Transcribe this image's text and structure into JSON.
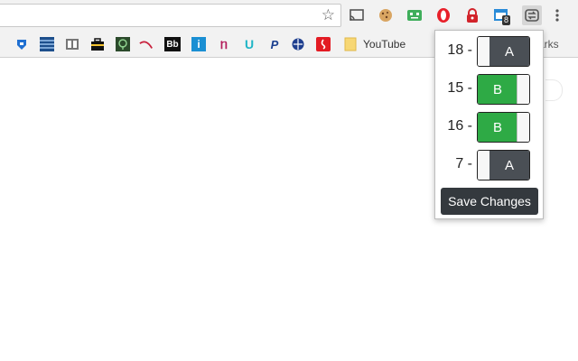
{
  "browser": {
    "toolbar_icons": [
      {
        "name": "cast-icon"
      },
      {
        "name": "cookie-icon"
      },
      {
        "name": "robot-icon"
      },
      {
        "name": "opera-icon"
      },
      {
        "name": "lock-icon"
      },
      {
        "name": "calendar-icon",
        "badge": "8"
      },
      {
        "name": "switch-extension-icon"
      },
      {
        "name": "menu-icon"
      }
    ],
    "bookmarks": {
      "youtube_label": "YouTube",
      "right_partial": "arks"
    }
  },
  "popup": {
    "rows": [
      {
        "label": "18 -",
        "state": "A",
        "value": "A"
      },
      {
        "label": "15 -",
        "state": "B",
        "value": "B"
      },
      {
        "label": "16 -",
        "state": "B",
        "value": "B"
      },
      {
        "label": "7 -",
        "state": "A",
        "value": "A"
      }
    ],
    "save_label": "Save Changes"
  },
  "colors": {
    "state_a": "#4a4f55",
    "state_b": "#2eaa45",
    "save_button": "#34393e"
  }
}
